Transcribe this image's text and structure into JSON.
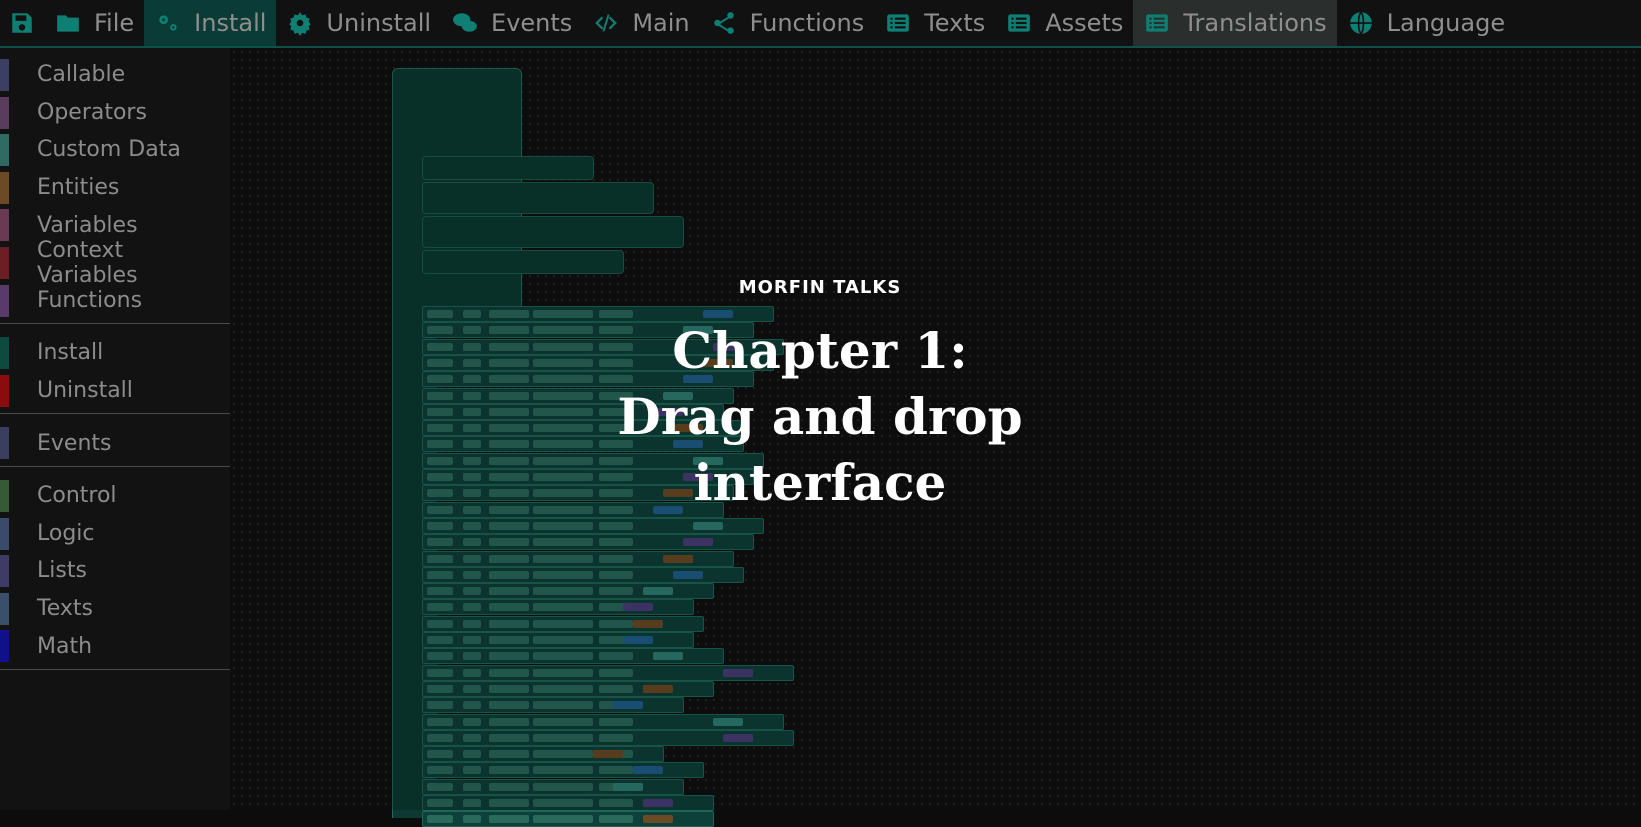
{
  "toolbar": {
    "items": [
      {
        "label": "",
        "icon": "save-icon"
      },
      {
        "label": "File",
        "icon": "folder-icon"
      },
      {
        "label": "Install",
        "icon": "gears-icon",
        "active": true
      },
      {
        "label": "Uninstall",
        "icon": "gear-icon"
      },
      {
        "label": "Events",
        "icon": "comments-icon"
      },
      {
        "label": "Main",
        "icon": "code-icon"
      },
      {
        "label": "Functions",
        "icon": "share-nodes-icon"
      },
      {
        "label": "Texts",
        "icon": "list-icon"
      },
      {
        "label": "Assets",
        "icon": "list-icon"
      },
      {
        "label": "Translations",
        "icon": "list-icon",
        "active": true
      },
      {
        "label": "Language",
        "icon": "globe-icon"
      }
    ]
  },
  "sidebar": {
    "groups": [
      [
        {
          "label": "Callable",
          "color": "#3a3f63"
        },
        {
          "label": "Operators",
          "color": "#5a3d5c"
        },
        {
          "label": "Custom Data",
          "color": "#2f6b63"
        },
        {
          "label": "Entities",
          "color": "#6b4a25"
        },
        {
          "label": "Variables",
          "color": "#6a3a55"
        },
        {
          "label": "Context Variables",
          "color": "#6b1f24"
        },
        {
          "label": "Functions",
          "color": "#5a3a6a"
        }
      ],
      [
        {
          "label": "Install",
          "color": "#0d4a40"
        },
        {
          "label": "Uninstall",
          "color": "#8a0c0c"
        }
      ],
      [
        {
          "label": "Events",
          "color": "#3a3f60"
        }
      ],
      [
        {
          "label": "Control",
          "color": "#355a35"
        },
        {
          "label": "Logic",
          "color": "#3b4a6a"
        },
        {
          "label": "Lists",
          "color": "#3f3a66"
        },
        {
          "label": "Texts",
          "color": "#3a4f6a"
        },
        {
          "label": "Math",
          "color": "#10108a"
        }
      ]
    ]
  },
  "overlay": {
    "kicker": "MORFIN TALKS",
    "title_line1": "Chapter 1:",
    "title_line2": "Drag and drop",
    "title_line3": "interface"
  }
}
